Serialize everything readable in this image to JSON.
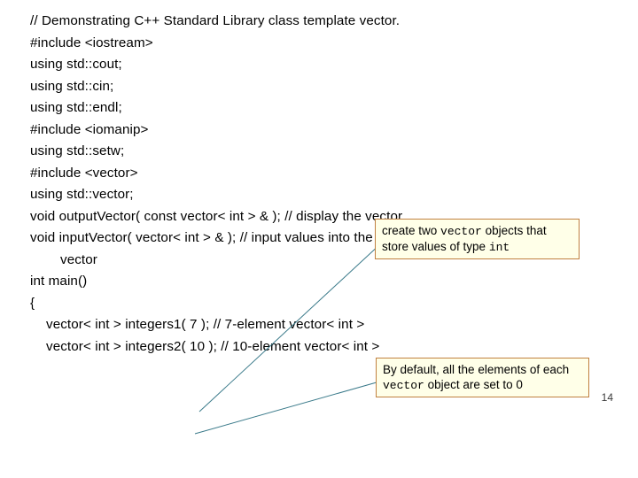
{
  "code": {
    "l1": "// Demonstrating C++ Standard Library class template vector.",
    "l2": "#include <iostream>",
    "l3": "using std::cout;",
    "l4": "using std::cin;",
    "l5": "using std::endl;",
    "l6": "",
    "l7": "#include <iomanip>",
    "l8": "using std::setw;",
    "l9": "",
    "l10": "#include <vector>",
    "l11": "using std::vector;",
    "l12": "",
    "l13": "void outputVector( const vector< int > & ); // display the vector",
    "l14a": "void inputVector( vector< int > & ); // input values into the ",
    "l14b": "vector",
    "l15": "",
    "l16": "int main()",
    "l17": "{",
    "l18": "vector< int > integers1( 7 ); // 7-element vector< int >",
    "l19": "vector< int > integers2( 10 ); // 10-element vector< int >"
  },
  "callouts": {
    "c1a": "create two ",
    "c1kw": "vector",
    "c1b": " objects that store values of type ",
    "c1c": "int",
    "c2a": "By default, all the elements of each ",
    "c2kw": "vector",
    "c2b": " object are set to 0"
  },
  "page_number": "14"
}
